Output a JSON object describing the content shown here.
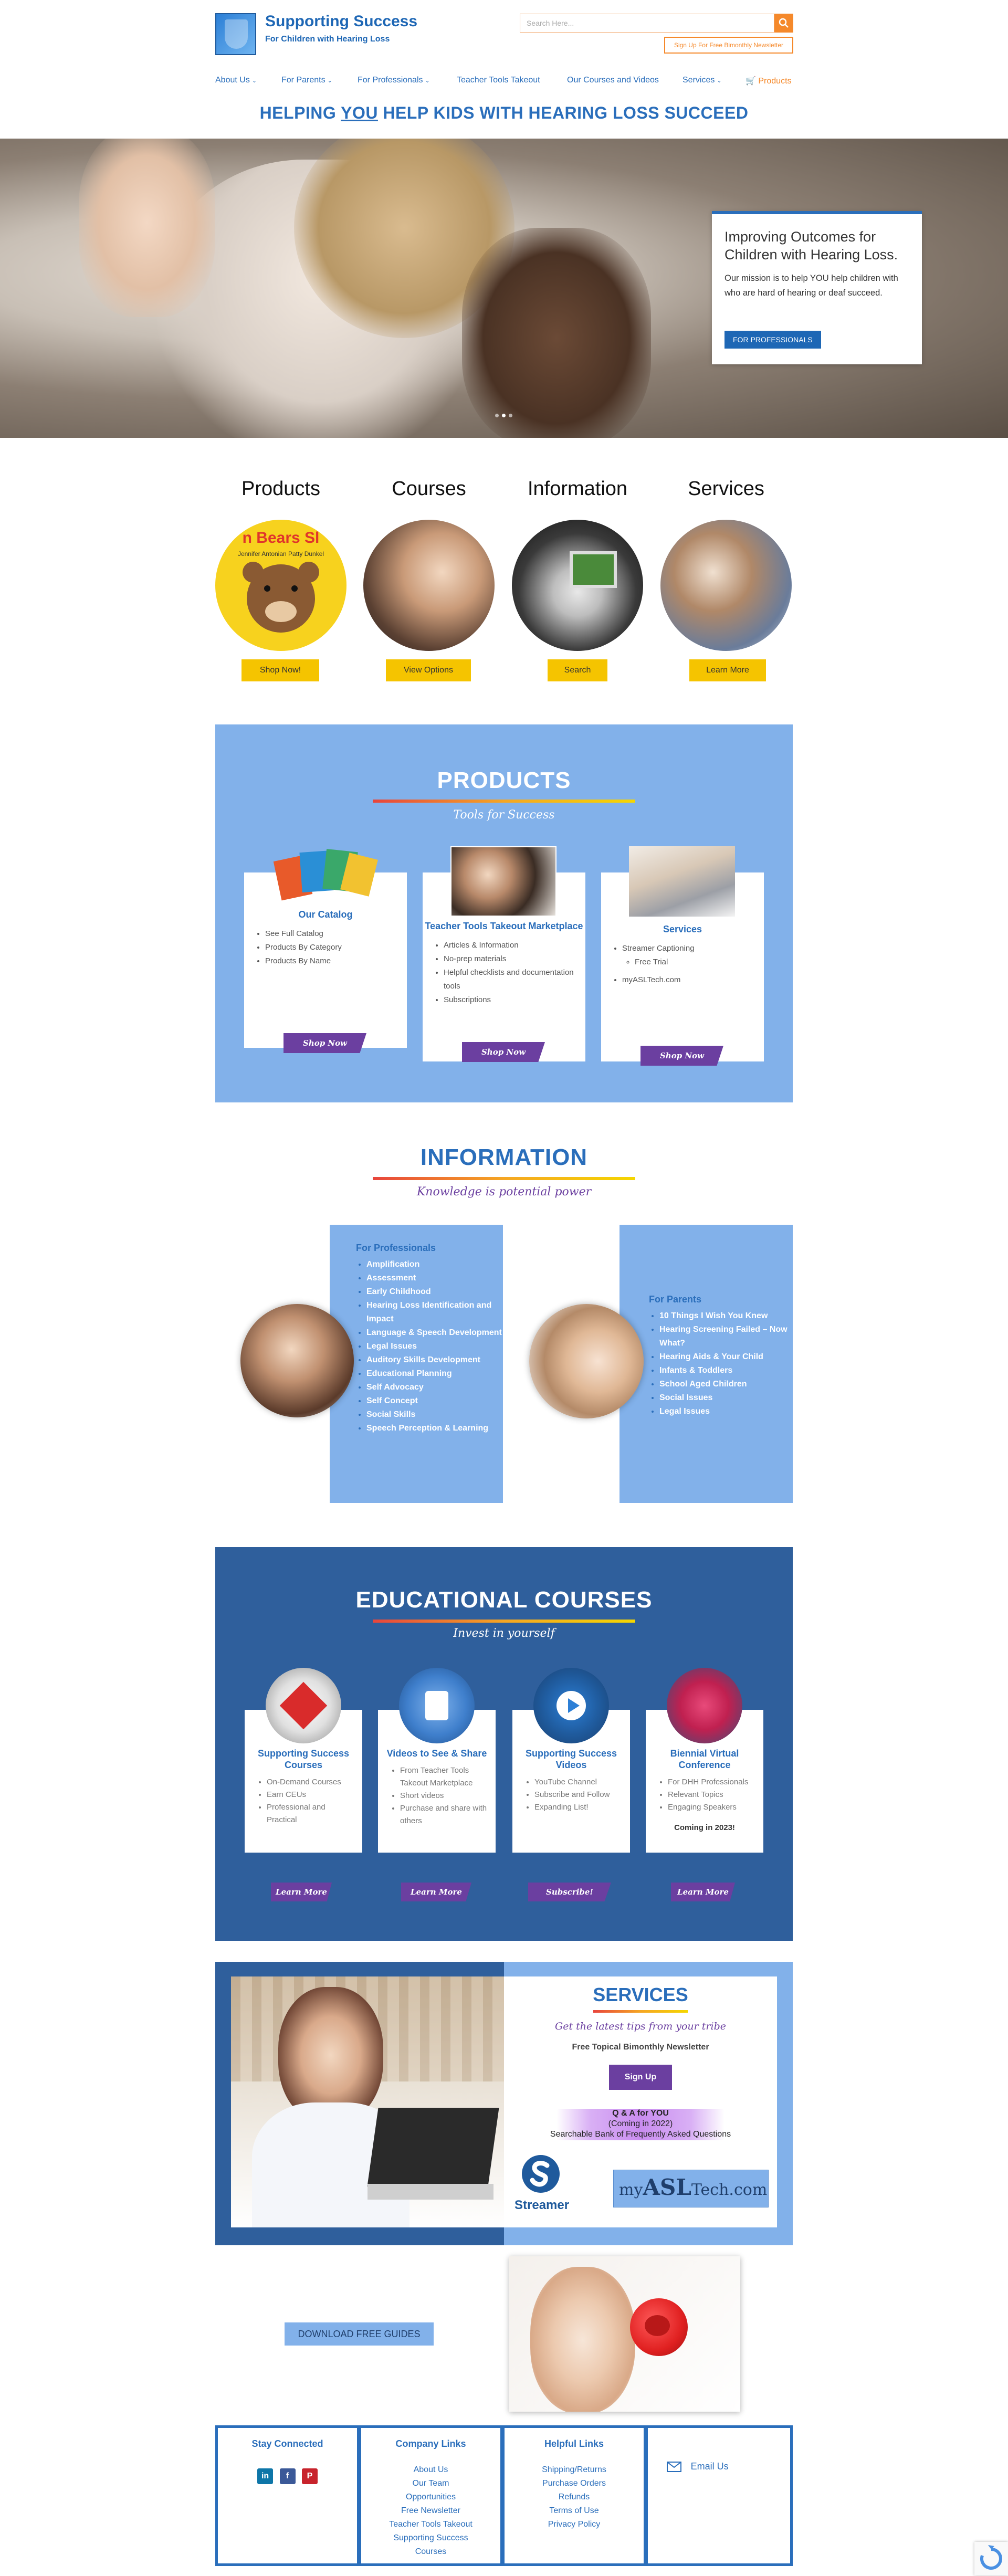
{
  "header": {
    "logo_title": "Supporting Success",
    "logo_subtitle": "For Children with Hearing Loss",
    "search_placeholder": "Search Here...",
    "newsletter_button": "Sign Up For Free Bimonthly Newsletter",
    "nav": [
      {
        "label": "About Us",
        "dropdown": true
      },
      {
        "label": "For Parents",
        "dropdown": true
      },
      {
        "label": "For Professionals",
        "dropdown": true
      },
      {
        "label": "Teacher Tools Takeout",
        "dropdown": false
      },
      {
        "label": "Our Courses and Videos",
        "dropdown": false
      },
      {
        "label": "Services",
        "dropdown": true
      },
      {
        "label": "Products",
        "dropdown": false,
        "icon": "cart-icon"
      }
    ],
    "tagline_before": "HELPING ",
    "tagline_emphasis": "YOU",
    "tagline_after": " HELP KIDS WITH HEARING LOSS SUCCEED"
  },
  "hero": {
    "title": "Improving Outcomes for Children with Hearing Loss.",
    "text": "Our mission is to help YOU help children with who are hard of hearing or deaf succeed.",
    "button": "FOR PROFESSIONALS"
  },
  "features": [
    {
      "title": "Products",
      "button": "Shop Now!",
      "image_text": "n Bears Sl",
      "image_subtext": "Jennifer Antonian   Patty Dunkel"
    },
    {
      "title": "Courses",
      "button": "View Options"
    },
    {
      "title": "Information",
      "button": "Search"
    },
    {
      "title": "Services",
      "button": "Learn More"
    }
  ],
  "products": {
    "title": "PRODUCTS",
    "subtitle": "Tools for Success",
    "cards": [
      {
        "title": "Our Catalog",
        "items": [
          "See Full Catalog",
          "Products By Category",
          "Products By Name"
        ],
        "button": "Shop Now"
      },
      {
        "title": "Teacher Tools Takeout Marketplace",
        "items": [
          "Articles & Information",
          "No-prep materials",
          "Helpful checklists and documentation tools",
          "Subscriptions"
        ],
        "button": "Shop Now"
      },
      {
        "title": "Services",
        "items": [
          "Streamer Captioning",
          "myASLTech.com"
        ],
        "subitems": [
          "Free Trial"
        ],
        "button": "Shop Now"
      }
    ]
  },
  "information": {
    "title": "INFORMATION",
    "subtitle": "Knowledge is potential power",
    "professionals": {
      "heading": "For Professionals",
      "items": [
        "Amplification",
        "Assessment",
        "Early Childhood",
        "Hearing Loss Identification and Impact",
        "Language & Speech Development",
        "Legal Issues",
        "Auditory Skills Development",
        "Educational Planning",
        "Self Advocacy",
        "Self Concept",
        "Social Skills",
        "Speech Perception & Learning"
      ]
    },
    "parents": {
      "heading": "For Parents",
      "items": [
        "10 Things I Wish You Knew",
        "Hearing Screening Failed – Now What?",
        "Hearing Aids & Your Child",
        "Infants & Toddlers",
        "School Aged Children",
        "Social Issues",
        "Legal Issues"
      ]
    }
  },
  "courses": {
    "title": "EDUCATIONAL COURSES",
    "subtitle": "Invest in yourself",
    "cards": [
      {
        "title": "Supporting Success Courses",
        "items": [
          "On-Demand Courses",
          "Earn CEUs",
          "Professional and Practical"
        ],
        "button": "Learn More"
      },
      {
        "title": "Videos to See & Share",
        "items": [
          "From Teacher Tools Takeout Marketplace",
          "Short videos",
          "Purchase and share with others"
        ],
        "button": "Learn More"
      },
      {
        "title": "Supporting Success Videos",
        "items": [
          "YouTube Channel",
          "Subscribe and Follow",
          "Expanding List!"
        ],
        "button": "Subscribe!"
      },
      {
        "title": "Biennial Virtual Conference",
        "items": [
          "For DHH Professionals",
          "Relevant Topics",
          "Engaging Speakers"
        ],
        "note": "Coming in 2023!",
        "button": "Learn More"
      }
    ]
  },
  "services": {
    "title": "SERVICES",
    "subtitle": "Get the latest tips from your tribe",
    "newsletter": "Free Topical Bimonthly Newsletter",
    "signup": "Sign Up",
    "qa_title": "Q & A for YOU",
    "qa_note": "(Coming in 2022)",
    "qa_desc": "Searchable Bank of Frequently Asked Questions",
    "streamer": "Streamer",
    "asltech_prefix": "my",
    "asltech_main": "ASL",
    "asltech_suffix": "Tech.com"
  },
  "download": {
    "button": "DOWNLOAD FREE GUIDES"
  },
  "footer": {
    "stay_connected": "Stay Connected",
    "company_links_title": "Company Links",
    "company_links": [
      "About Us",
      "Our Team",
      "Opportunities",
      "Free Newsletter",
      "Teacher Tools Takeout",
      "Supporting Success Courses"
    ],
    "helpful_links_title": "Helpful Links",
    "helpful_links": [
      "Shipping/Returns",
      "Purchase Orders",
      "Refunds",
      "Terms of Use",
      "Privacy Policy"
    ],
    "email": "Email Us",
    "social": [
      "in",
      "f",
      "P"
    ]
  },
  "colors": {
    "brand_blue": "#2a6ebb",
    "accent_orange": "#f5892b",
    "light_blue": "#82b1ea",
    "dark_blue": "#2f5f9c",
    "purple": "#6b3fa0",
    "yellow": "#f5c400"
  }
}
